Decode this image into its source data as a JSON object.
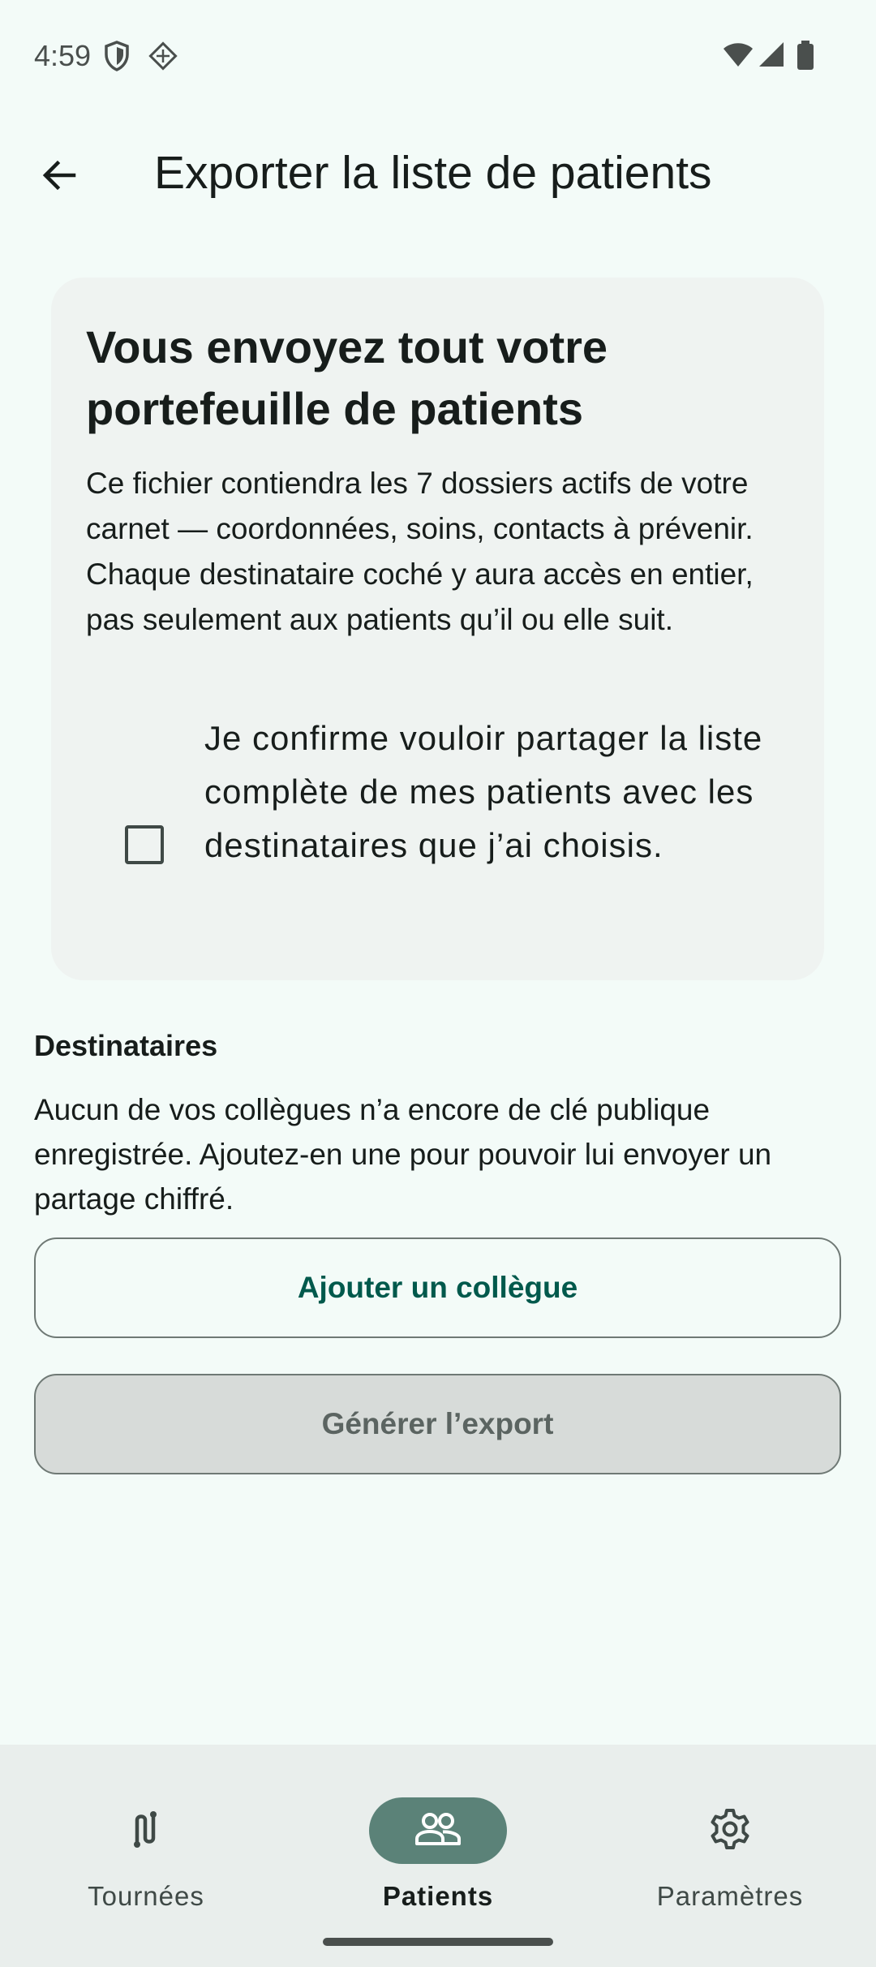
{
  "status_bar": {
    "time": "4:59"
  },
  "app_bar": {
    "title": "Exporter la liste de patients"
  },
  "warning_card": {
    "title": "Vous envoyez tout votre portefeuille de patients",
    "body": "Ce fichier contiendra les 7 dossiers actifs de votre carnet — coordonnées, soins, contacts à prévenir. Chaque destinataire coché y aura accès en entier, pas seulement aux patients qu’il ou elle suit.",
    "confirm_label": "Je confirme vouloir partager la liste complète de mes patients avec les destinataires que j’ai choisis.",
    "confirm_checked": false
  },
  "recipients": {
    "title": "Destinataires",
    "empty_message": "Aucun de vos collègues n’a encore de clé publique enregistrée. Ajoutez-en une pour pouvoir lui envoyer un partage chiffré.",
    "add_button": "Ajouter un collègue"
  },
  "generate_button": "Générer l’export",
  "bottom_nav": {
    "items": [
      {
        "label": "Tournées",
        "icon": "route-icon",
        "active": false
      },
      {
        "label": "Patients",
        "icon": "people-icon",
        "active": true
      },
      {
        "label": "Paramètres",
        "icon": "gear-icon",
        "active": false
      }
    ]
  },
  "colors": {
    "background": "#f3fbf8",
    "card": "#eff3f1",
    "primary_text": "#00594c",
    "active_pill": "#5b8278",
    "disabled_button": "#d7dbd9"
  }
}
